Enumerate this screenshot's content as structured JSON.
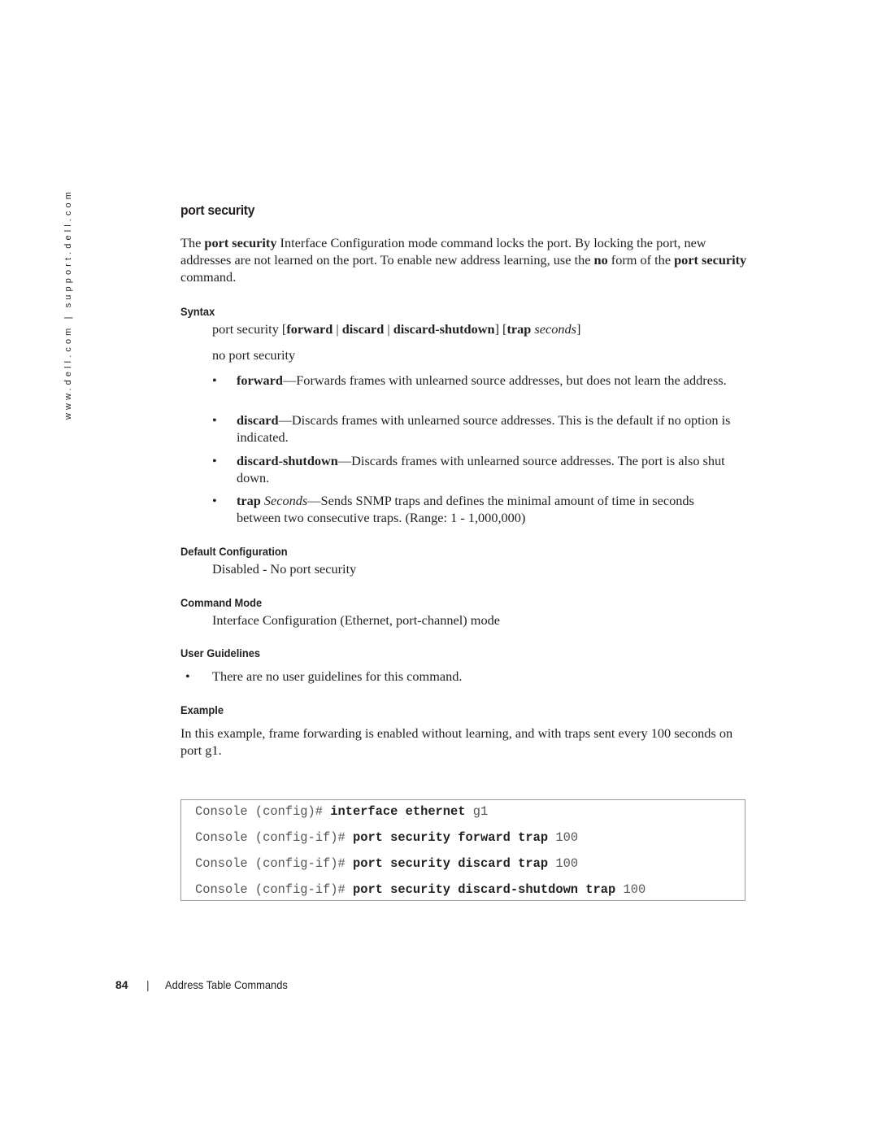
{
  "sidebar": {
    "url_text": "www.dell.com | support.dell.com"
  },
  "section": {
    "title": "port security",
    "intro": {
      "t1": "The ",
      "b1": "port security",
      "t2": " Interface Configuration mode command locks the port. By locking the port, new addresses are not learned on the port. To enable new address learning, use the ",
      "b2": "no",
      "t3": " form of the ",
      "b3": "port security",
      "t4": " command."
    }
  },
  "syntax": {
    "heading": "Syntax",
    "line1": {
      "cmd": "port security [",
      "opt1": "forward",
      "sep1": " | ",
      "opt2": "discard",
      "sep2": " | ",
      "opt3": "discard-shutdown",
      "mid": "] [",
      "opt4": "trap",
      "space": " ",
      "arg": "seconds",
      "end": "]"
    },
    "line2": "no port security",
    "bullets": [
      {
        "term": "forward",
        "term_italic": "",
        "desc": "—Forwards frames with unlearned source addresses, but does not learn the address."
      },
      {
        "term": "discard",
        "term_italic": "",
        "desc": "—Discards frames with unlearned source addresses. This is the default if no option is indicated."
      },
      {
        "term": "discard-shutdown",
        "term_italic": "",
        "desc": "—Discards frames with unlearned source addresses. The port is also shut down."
      },
      {
        "term": "trap",
        "term_italic": " Seconds",
        "desc": "—Sends SNMP traps and defines the minimal amount of time in seconds between two consecutive traps. (Range: 1 - 1,000,000)"
      }
    ]
  },
  "default_configuration": {
    "heading": "Default Configuration",
    "text": "Disabled - No port security"
  },
  "command_mode": {
    "heading": "Command Mode",
    "text": "Interface Configuration (Ethernet, port-channel) mode"
  },
  "user_guidelines": {
    "heading": "User Guidelines",
    "bullets": [
      "There are no user guidelines for this command."
    ]
  },
  "example": {
    "heading": "Example",
    "text": "In this example, frame forwarding is enabled without learning, and with traps sent every 100 seconds on port g1.",
    "code_lines": [
      {
        "prompt": "Console (config)# ",
        "cmd": "interface ethernet",
        "arg": " g1"
      },
      {
        "prompt": "Console (config-if)# ",
        "cmd": "port security forward trap",
        "arg": " 100"
      },
      {
        "prompt": "Console (config-if)# ",
        "cmd": "port security discard trap",
        "arg": " 100"
      },
      {
        "prompt": "Console (config-if)# ",
        "cmd": "port security discard-shutdown trap",
        "arg": " 100"
      }
    ]
  },
  "footer": {
    "page_number": "84",
    "separator": "|",
    "chapter_title": "Address Table Commands"
  }
}
